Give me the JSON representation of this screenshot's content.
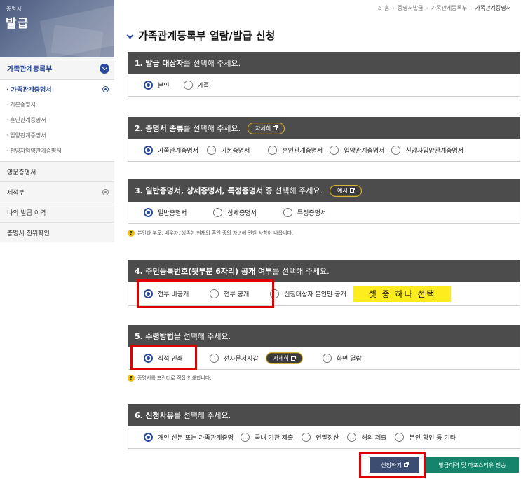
{
  "sidebar": {
    "banner_small": "증명서",
    "banner_big": "발급",
    "head_label": "가족관계등록부",
    "sub_items": [
      "· 가족관계증명서",
      "· 기본증명서",
      "· 혼인관계증명서",
      "· 입양관계증명서",
      "· 친양자입양관계증명서"
    ],
    "menu_items": [
      "영문증명서",
      "제적부",
      "나의 발급 이력",
      "증명서 진위확인"
    ]
  },
  "breadcrumb": {
    "home": "홈",
    "level1": "증명서발급",
    "level2": "가족관계등록부",
    "current": "가족관계증명서"
  },
  "page_title": "가족관계등록부 열람/발급 신청",
  "sections": [
    {
      "num": "1.",
      "bold": "발급 대상자",
      "rest": "를 선택해 주세요.",
      "options": [
        "본인",
        "가족"
      ],
      "selected": 0
    },
    {
      "num": "2.",
      "bold": "증명서 종류",
      "rest": "를 선택해 주세요.",
      "pill": "자세히",
      "options": [
        "가족관계증명서",
        "기본증명서",
        "혼인관계증명서",
        "입양관계증명서",
        "친양자입양관계증명서"
      ],
      "selected": 0
    },
    {
      "num": "3.",
      "bold": "일반증명서, 상세증명서, 특정증명서",
      "rest": " 중 선택해 주세요.",
      "pill": "예시",
      "options": [
        "일반증명서",
        "상세증명서",
        "특정증명서"
      ],
      "selected": 0,
      "note": "본인과 부모, 배우자, 생존한 현재의 혼인 중의 자녀에 관한 사항이 나옵니다."
    },
    {
      "num": "4.",
      "bold": "주민등록번호(뒷부분 6자리) 공개 여부",
      "rest": "를 선택해 주세요.",
      "options": [
        "전부 비공개",
        "전부 공개",
        "신청대상자 본인만 공개"
      ],
      "selected": 0,
      "highlight": "셋 중 하나 선택"
    },
    {
      "num": "5.",
      "bold": "수령방법",
      "rest": "을 선택해 주세요.",
      "options": [
        "직접 인쇄",
        "전자문서지갑",
        "화면 열람"
      ],
      "selected": 0,
      "pill": "자세히",
      "note": "증명서를 프린터로 직접 인쇄합니다."
    },
    {
      "num": "6.",
      "bold": "신청사유",
      "rest": "를 선택해 주세요.",
      "options": [
        "개인 신분 또는 가족관계증명",
        "국내 기관 제출",
        "연말정산",
        "해외 제출",
        "본인 확인 등 기타"
      ],
      "selected": 0
    }
  ],
  "buttons": {
    "apply": "신청하기",
    "send": "발급이력 및 아포스티유 전송"
  },
  "colors": {
    "accent": "#2b4a9a",
    "section_header": "#4c4c4c",
    "highlight": "#ffec1f",
    "red_box": "#e00000",
    "send_button": "#14856c"
  }
}
